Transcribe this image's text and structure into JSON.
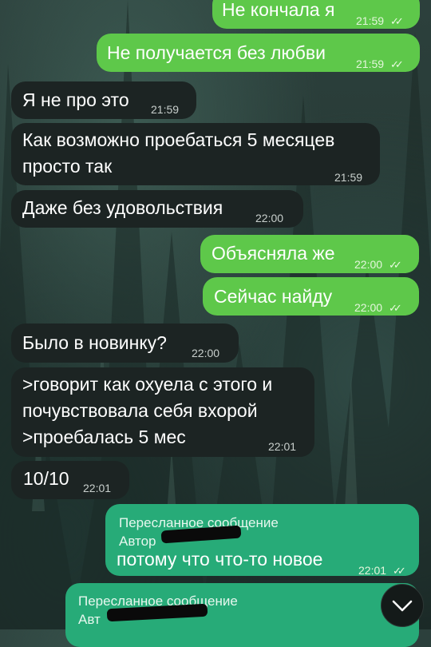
{
  "messages": [
    {
      "text": "Не кончала я",
      "time": "21:59"
    },
    {
      "text": "Не получается без любви",
      "time": "21:59"
    },
    {
      "text": "Я не про это",
      "time": "21:59"
    },
    {
      "text": "Как возможно проебаться 5 месяцев\nпросто так",
      "time": "21:59"
    },
    {
      "text": "Даже без удовольствия",
      "time": "22:00"
    },
    {
      "text": "Объясняла же",
      "time": "22:00"
    },
    {
      "text": "Сейчас найду",
      "time": "22:00"
    },
    {
      "text": "Было в новинку?",
      "time": "22:00"
    },
    {
      "text": ">говорит как охуела с этого и\nпочувствовала себя вхорой\n>проебалась 5 мес",
      "time": "22:01"
    },
    {
      "text": "10/10",
      "time": "22:01"
    },
    {
      "text": "потому что что-то новое",
      "time": "22:01",
      "fwd_title": "Пересланное сообщение",
      "fwd_author": "Автор"
    },
    {
      "text": "",
      "time": "",
      "fwd_title": "Пересланное сообщение",
      "fwd_author": "Авт"
    }
  ],
  "read_checks": "✓✓",
  "scroll_button_icon": "chevron-down-icon",
  "colors": {
    "incoming": "#1c2423",
    "outgoing": "#5ec84a",
    "forwarded": "#27ab78"
  }
}
